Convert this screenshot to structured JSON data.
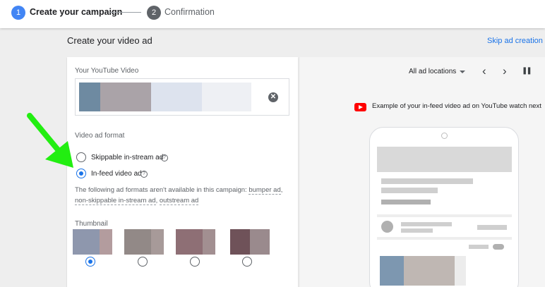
{
  "stepper": {
    "step1_number": "1",
    "step1_label": "Create your campaign",
    "step2_number": "2",
    "step2_label": "Confirmation"
  },
  "page_title": "Create your video ad",
  "skip_link": "Skip ad creation (",
  "video": {
    "label": "Your YouTube Video",
    "clear_icon": "close-circle-icon",
    "clear_glyph": "✕"
  },
  "format": {
    "label": "Video ad format",
    "options": [
      {
        "label": "Skippable in-stream ad",
        "selected": false
      },
      {
        "label": "In-feed video ad",
        "selected": true
      }
    ],
    "help_glyph": "?",
    "note_prefix": "The following ad formats aren't available in this campaign: ",
    "note_links": [
      "bumper ad",
      "non-skippable in-stream ad",
      "outstream ad"
    ],
    "note_sep": ", "
  },
  "thumbnail": {
    "label": "Thumbnail",
    "options_selected_index": 0
  },
  "preview": {
    "locations_label": "All ad locations",
    "prev_glyph": "‹",
    "next_glyph": "›",
    "pause_glyph": "❚❚",
    "example_text": "Example of your in-feed video ad on YouTube watch next"
  },
  "colors": {
    "accent": "#1a73e8",
    "step_active": "#4285f4",
    "youtube_red": "#ff0000",
    "annotation_arrow": "#22ee11"
  }
}
